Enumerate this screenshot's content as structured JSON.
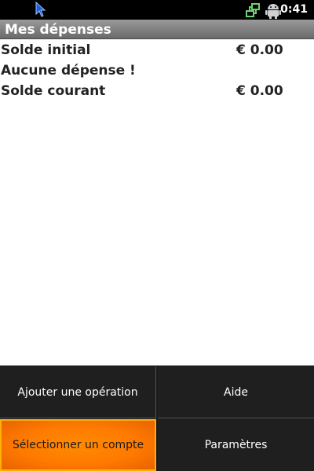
{
  "status_bar": {
    "time": "0:41",
    "icons": [
      "cursor-icon",
      "network-icon",
      "android-robot-icon"
    ]
  },
  "title_bar": {
    "title": "Mes dépenses"
  },
  "rows": [
    {
      "label": "Solde initial",
      "value": "€ 0.00"
    },
    {
      "label": "Aucune dépense !",
      "value": ""
    },
    {
      "label": "Solde courant",
      "value": "€ 0.00"
    }
  ],
  "menu": {
    "items": [
      {
        "label": "Ajouter une opération"
      },
      {
        "label": "Aide"
      },
      {
        "label": "Sélectionner un compte"
      },
      {
        "label": "Paramètres"
      }
    ],
    "selected": "Sélectionner un compte",
    "accent_color": "#ff7a00"
  }
}
